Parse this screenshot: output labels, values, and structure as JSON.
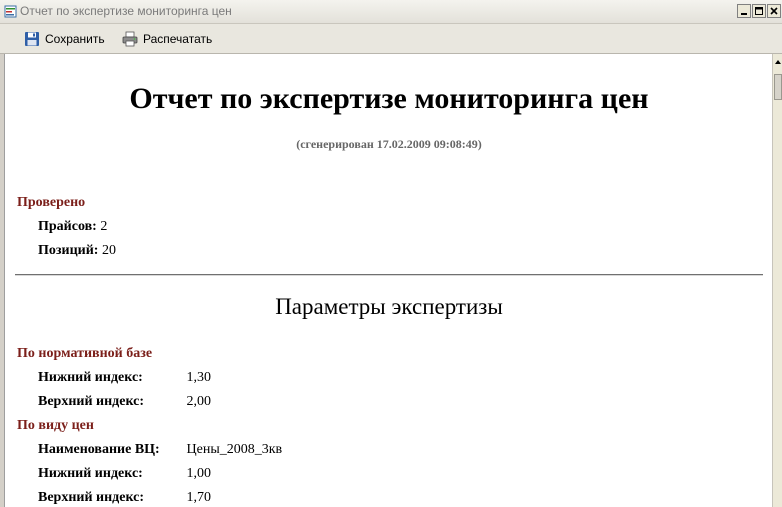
{
  "window": {
    "title": "Отчет по экспертизе мониторинга цен"
  },
  "toolbar": {
    "save_label": "Сохранить",
    "print_label": "Распечатать"
  },
  "report": {
    "title": "Отчет по экспертизе мониторинга цен",
    "generated": "(сгенерирован 17.02.2009 09:08:49)",
    "checked": {
      "heading": "Проверено",
      "rows": [
        {
          "label": "Прайсов:",
          "value": "2"
        },
        {
          "label": "Позиций:",
          "value": "20"
        }
      ]
    },
    "params_title": "Параметры экспертизы",
    "normative": {
      "heading": "По нормативной базе",
      "rows": [
        {
          "label": "Нижний индекс:",
          "value": "1,30"
        },
        {
          "label": "Верхний индекс:",
          "value": "2,00"
        }
      ]
    },
    "price_type": {
      "heading": "По виду цен",
      "rows": [
        {
          "label": "Наименование ВЦ:",
          "value": "Цены_2008_3кв"
        },
        {
          "label": "Нижний индекс:",
          "value": "1,00"
        },
        {
          "label": "Верхний индекс:",
          "value": "1,70"
        }
      ]
    }
  },
  "colors": {
    "section_heading": "#7b1f1a",
    "window_bg": "#d4d0c8"
  }
}
